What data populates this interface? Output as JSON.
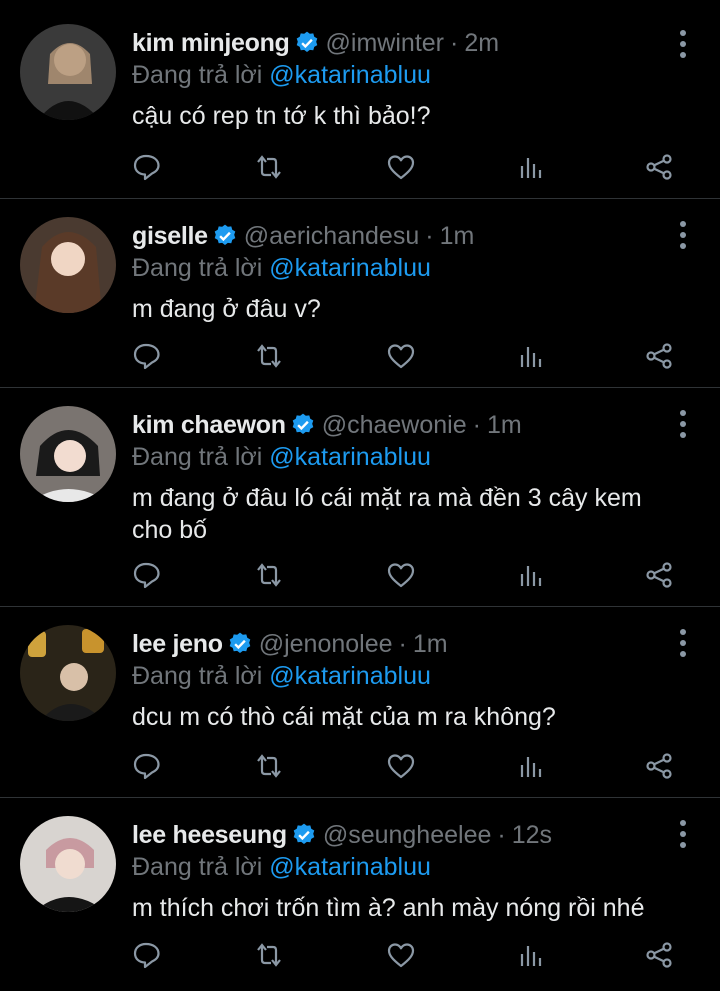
{
  "reply_prefix": "Đang trả lời",
  "colors": {
    "background": "#000000",
    "accent": "#1d9bf0",
    "muted": "#71767b",
    "text": "#e7e9ea"
  },
  "icons": [
    "comment-icon",
    "retweet-icon",
    "like-icon",
    "analytics-icon",
    "share-icon",
    "more-icon",
    "verified-badge-icon"
  ],
  "tweets": [
    {
      "name": "kim minjeong",
      "verified": true,
      "handle": "@imwinter",
      "time": "2m",
      "reply_to": "@katarinabluu",
      "text": "cậu có rep tn tớ k thì bảo!?"
    },
    {
      "name": "giselle",
      "verified": true,
      "handle": "@aerichandesu",
      "time": "1m",
      "reply_to": "@katarinabluu",
      "text": "m đang ở đâu v?"
    },
    {
      "name": "kim chaewon",
      "verified": true,
      "handle": "@chaewonie",
      "time": "1m",
      "reply_to": "@katarinabluu",
      "text": "m đang ở đâu ló cái mặt ra mà đền 3 cây kem cho bố"
    },
    {
      "name": "lee jeno",
      "verified": true,
      "handle": "@jenonolee",
      "time": "1m",
      "reply_to": "@katarinabluu",
      "text": "dcu m có thò cái mặt của m ra không?"
    },
    {
      "name": "lee heeseung",
      "verified": true,
      "handle": "@seungheelee",
      "time": "12s",
      "reply_to": "@katarinabluu",
      "text": "m thích chơi trốn tìm à? anh mày nóng rồi nhé"
    }
  ]
}
